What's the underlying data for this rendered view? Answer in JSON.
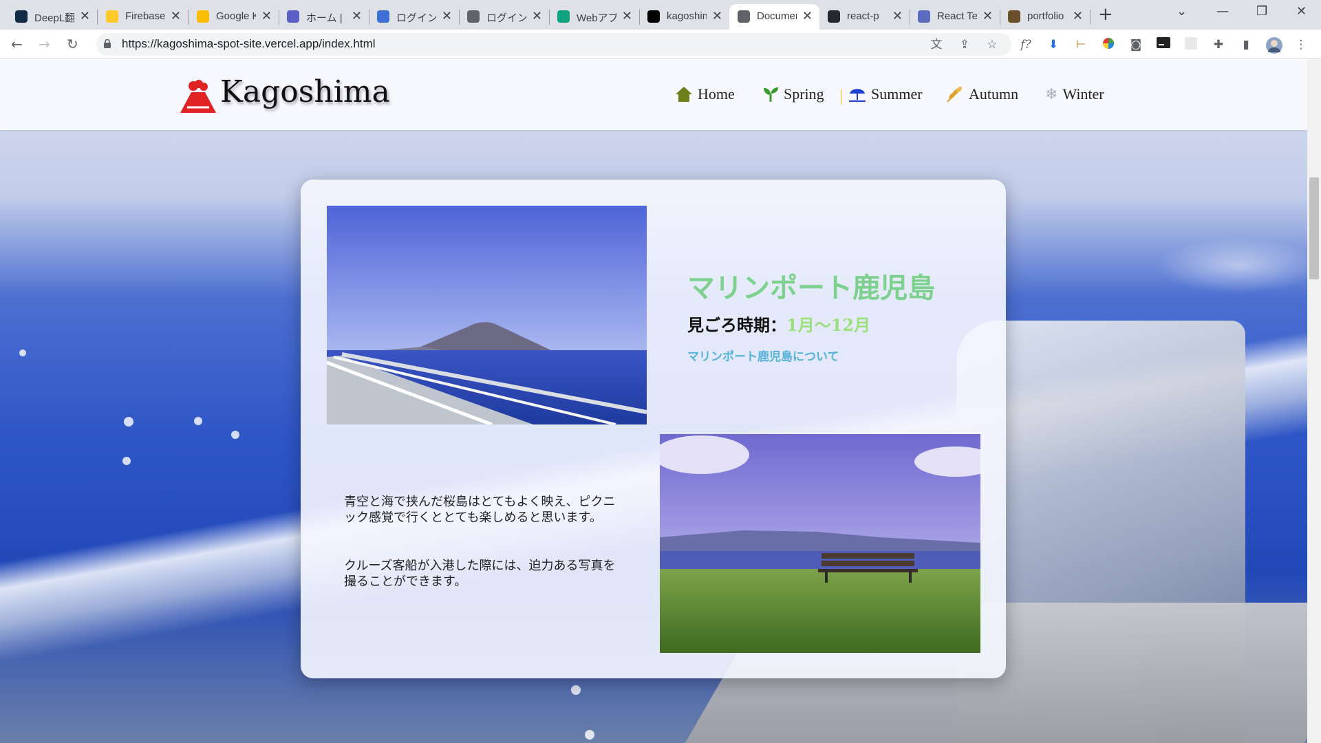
{
  "browser": {
    "tabs": [
      {
        "label": "DeepL翻訳",
        "icon": "deepl-icon",
        "color": "#0f2b46"
      },
      {
        "label": "Firebase",
        "icon": "firebase-icon",
        "color": "#ffca28"
      },
      {
        "label": "Google Keep",
        "icon": "keep-icon",
        "color": "#fbbc04"
      },
      {
        "label": "ホーム | M",
        "icon": "app-icon",
        "color": "#5b5fc7"
      },
      {
        "label": "ログイン画面",
        "icon": "login-icon",
        "color": "#3d6fd6"
      },
      {
        "label": "ログイン|",
        "icon": "globe-icon",
        "color": "#5f6368"
      },
      {
        "label": "Webアプリ",
        "icon": "chatgpt-icon",
        "color": "#10a37f"
      },
      {
        "label": "kagoshima",
        "icon": "vercel-icon",
        "color": "#000000"
      },
      {
        "label": "Document",
        "icon": "globe-icon",
        "color": "#5f6368"
      },
      {
        "label": "react-p",
        "icon": "github-icon",
        "color": "#24292f"
      },
      {
        "label": "React Te",
        "icon": "react-testing-icon",
        "color": "#5c6bc0"
      },
      {
        "label": "portfolio",
        "icon": "portfolio-icon",
        "color": "#6b4f2a"
      }
    ],
    "active_tab": 8,
    "url": "https://kagoshima-spot-site.vercel.app/index.html"
  },
  "site": {
    "logo_text": "Kagoshima",
    "nav": [
      {
        "label": "Home",
        "icon": "home-icon",
        "color": "#6b7f1a"
      },
      {
        "label": "Spring",
        "icon": "sprout-icon",
        "color": "#3a9a2a"
      },
      {
        "label": "Summer",
        "icon": "beach-umbrella-icon",
        "color": "#1e3fd0"
      },
      {
        "label": "Autumn",
        "icon": "wheat-icon",
        "color": "#e0a030"
      },
      {
        "label": "Winter",
        "icon": "snowflake-icon",
        "color": "#a8b0bd"
      }
    ]
  },
  "spot": {
    "title": "マリンポート鹿児島",
    "season_label": "見ごろ時期：",
    "season_value": "1月～12月",
    "about_link": "マリンポート鹿児島について",
    "description": [
      "青空と海で挟んだ桜島はとてもよく映え、ピクニック感覚で行くととても楽しめると思います。",
      "クルーズ客船が入港した際には、迫力ある写真を撮ることができます。"
    ]
  },
  "colors": {
    "title_green": "#7ed08e",
    "season_value_green": "#9be07a",
    "link_blue": "#56b2d8",
    "logo_red": "#e02424"
  }
}
